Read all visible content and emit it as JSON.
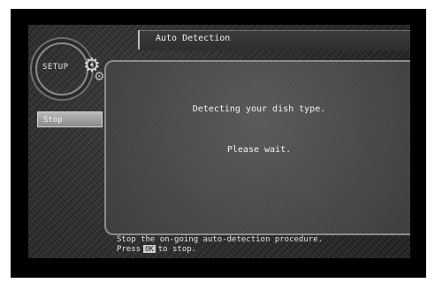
{
  "sidebar": {
    "logo_text": "SETUP",
    "stop_label": "Stop",
    "icon": "gear-icon"
  },
  "header": {
    "title": "Auto Detection"
  },
  "dialog": {
    "line1": "Detecting your dish type.",
    "line2": "Please wait."
  },
  "help": {
    "line1": "Stop the on-going auto-detection procedure.",
    "press": "Press",
    "key": "OK",
    "to_stop": "to stop."
  }
}
